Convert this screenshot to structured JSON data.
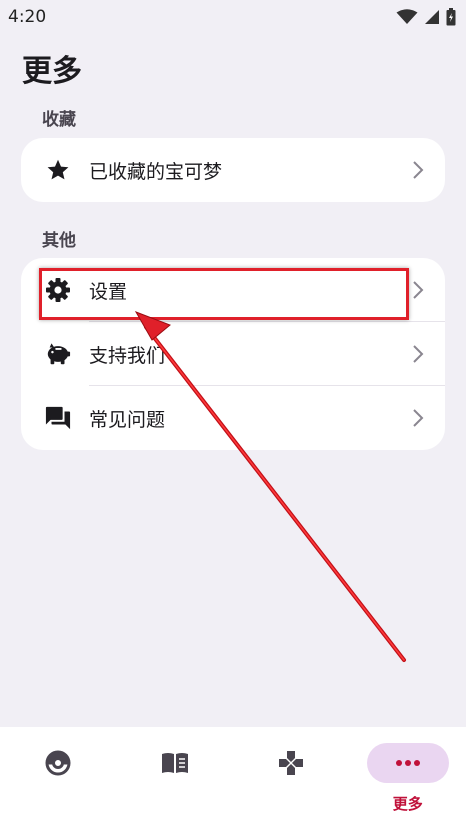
{
  "status_bar": {
    "time": "4:20"
  },
  "page_title": "更多",
  "sections": [
    {
      "label": "收藏",
      "items": [
        {
          "label": "已收藏的宝可梦",
          "icon": "star-icon"
        }
      ]
    },
    {
      "label": "其他",
      "items": [
        {
          "label": "设置",
          "icon": "gear-icon"
        },
        {
          "label": "支持我们",
          "icon": "piggy-bank-icon"
        },
        {
          "label": "常见问题",
          "icon": "chat-bubbles-icon"
        }
      ]
    }
  ],
  "bottom_nav": {
    "items": [
      {
        "icon": "pokeball-icon",
        "label": ""
      },
      {
        "icon": "book-icon",
        "label": ""
      },
      {
        "icon": "gamepad-icon",
        "label": ""
      },
      {
        "icon": "more-dots-icon",
        "label": "更多",
        "active": true
      }
    ]
  },
  "colors": {
    "background": "#f1eff5",
    "card": "#ffffff",
    "accent": "#c0113a",
    "active_pill": "#ead6f1",
    "annotation_red": "#e0202a"
  }
}
